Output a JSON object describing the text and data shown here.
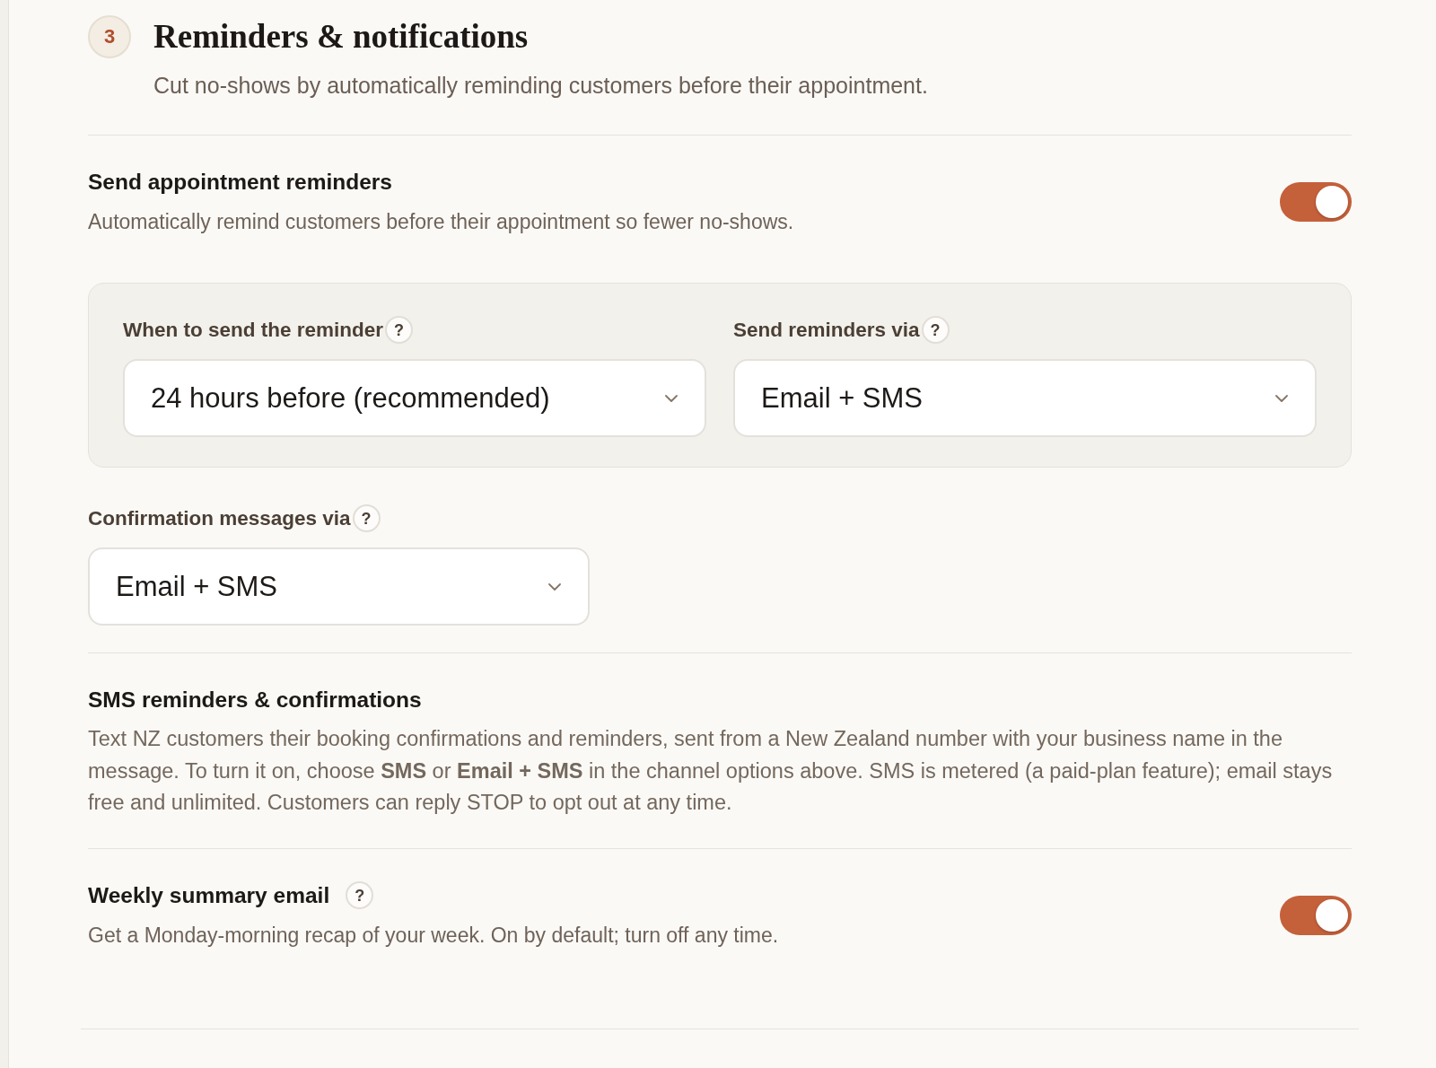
{
  "section": {
    "step": "3",
    "title": "Reminders & notifications",
    "subtitle": "Cut no-shows by automatically reminding customers before their appointment."
  },
  "reminders": {
    "title": "Send appointment reminders",
    "description": "Automatically remind customers before their appointment so fewer no-shows.",
    "on": true
  },
  "reminder_options": [
    {
      "label": "When to send the reminder",
      "help": "?",
      "value": "24 hours before (recommended)"
    },
    {
      "label": "Send reminders via",
      "help": "?",
      "value": "Email + SMS"
    }
  ],
  "confirmation": {
    "label": "Confirmation messages via",
    "help": "?",
    "value": "Email + SMS"
  },
  "sms_info": {
    "title": "SMS reminders & confirmations",
    "text": "Text NZ customers their booking confirmations and reminders, sent from a New Zealand number with your business name in the message. To turn it on, choose **SMS** or **Email + SMS** in the channel options above. SMS is metered (a paid-plan feature); email stays free and unlimited. Customers can reply STOP to opt out at any time."
  },
  "weekly_summary": {
    "title": "Weekly summary email",
    "help": "?",
    "description": "Get a Monday-morning recap of your week. On by default; turn off any time.",
    "on": true
  }
}
